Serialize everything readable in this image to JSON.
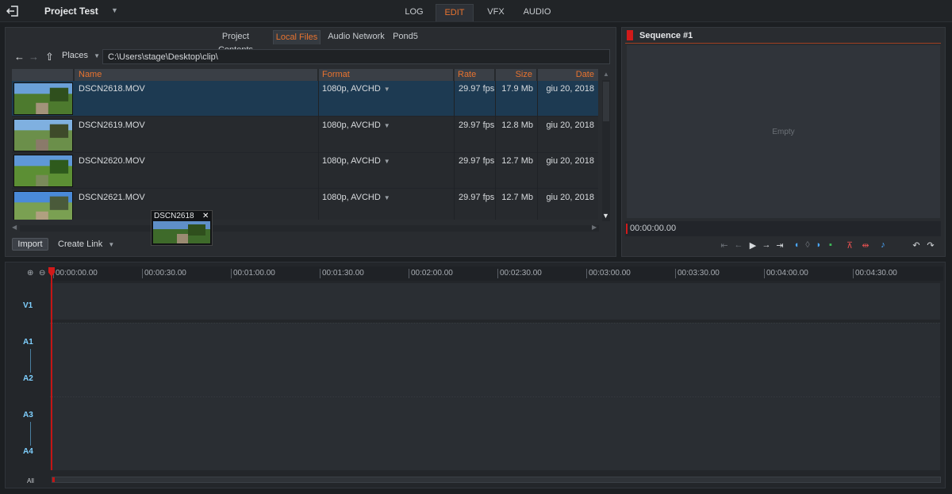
{
  "app": {
    "project_title": "Project Test",
    "project_caret": "▼",
    "tabs": [
      {
        "label": "LOG"
      },
      {
        "label": "EDIT"
      },
      {
        "label": "VFX"
      },
      {
        "label": "AUDIO"
      }
    ],
    "active_tab": "EDIT",
    "accent_color": "#e8732f"
  },
  "library": {
    "tabs": [
      {
        "label": "Project Contents"
      },
      {
        "label": "Local Files"
      },
      {
        "label": "Audio Network"
      },
      {
        "label": "Pond5"
      }
    ],
    "active_tab": "Local Files",
    "places_label": "Places",
    "places_caret": "▼",
    "path": "C:\\Users\\stage\\Desktop\\clip\\",
    "columns": [
      "Name",
      "Format",
      "Rate",
      "Size",
      "Date"
    ],
    "rows": [
      {
        "name": "DSCN2618.MOV",
        "format": "1080p, AVCHD",
        "rate": "29.97 fps",
        "size": "17.9 Mb",
        "date": "giu 20, 2018",
        "selected": true
      },
      {
        "name": "DSCN2619.MOV",
        "format": "1080p, AVCHD",
        "rate": "29.97 fps",
        "size": "12.8 Mb",
        "date": "giu 20, 2018",
        "selected": false
      },
      {
        "name": "DSCN2620.MOV",
        "format": "1080p, AVCHD",
        "rate": "29.97 fps",
        "size": "12.7 Mb",
        "date": "giu 20, 2018",
        "selected": false
      },
      {
        "name": "DSCN2621.MOV",
        "format": "1080p, AVCHD",
        "rate": "29.97 fps",
        "size": "12.7 Mb",
        "date": "giu 20, 2018",
        "selected": false
      }
    ],
    "format_caret": "▼",
    "import_label": "Import",
    "create_link_label": "Create Link",
    "create_link_caret": "▼",
    "drag_tooltip": {
      "label": "DSCN2618",
      "close": "✕"
    }
  },
  "viewer": {
    "title": "Sequence #1",
    "empty_text": "Empty",
    "timecode": "00:00:00.00"
  },
  "timeline": {
    "ruler_labels": [
      "00:00:00.00",
      "00:00:30.00",
      "00:01:00.00",
      "00:01:30.00",
      "00:02:00.00",
      "00:02:30.00",
      "00:03:00.00",
      "00:03:30.00",
      "00:04:00.00",
      "00:04:30.00"
    ],
    "tracks": [
      "V1",
      "A1",
      "A2",
      "A3",
      "A4"
    ],
    "all_label": "All"
  },
  "icons": {
    "exit": "exit-icon",
    "back": "←",
    "forward": "→",
    "up": "⇧",
    "zoom_in": "⊕",
    "zoom_out": "⊖"
  }
}
